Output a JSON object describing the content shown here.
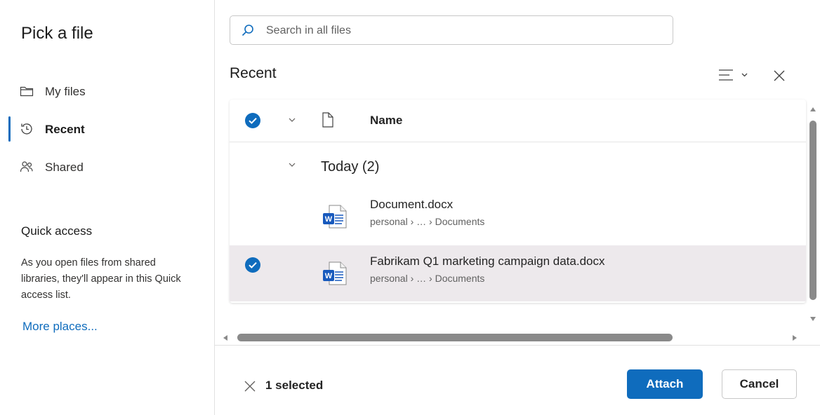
{
  "dialog": {
    "title": "Pick a file"
  },
  "nav": {
    "items": [
      {
        "label": "My files",
        "icon": "folder-icon",
        "active": false
      },
      {
        "label": "Recent",
        "icon": "recent-clock-icon",
        "active": true
      },
      {
        "label": "Shared",
        "icon": "people-icon",
        "active": false
      }
    ]
  },
  "quick_access": {
    "heading": "Quick access",
    "description": "As you open files from shared libraries, they'll appear in this Quick access list.",
    "more_link": "More places..."
  },
  "search": {
    "placeholder": "Search in all files"
  },
  "main": {
    "title": "Recent",
    "columns": {
      "name": "Name"
    },
    "groups": [
      {
        "label": "Today (2)",
        "files": [
          {
            "name": "Document.docx",
            "path": "personal › … › Documents",
            "selected": false
          },
          {
            "name": "Fabrikam Q1 marketing campaign data.docx",
            "path": "personal › … › Documents",
            "selected": true
          }
        ]
      }
    ]
  },
  "footer": {
    "selected_text": "1 selected",
    "attach_label": "Attach",
    "cancel_label": "Cancel"
  },
  "colors": {
    "accent": "#0f6cbd",
    "selected_row": "#ede9ec",
    "word_blue": "#185abd"
  }
}
